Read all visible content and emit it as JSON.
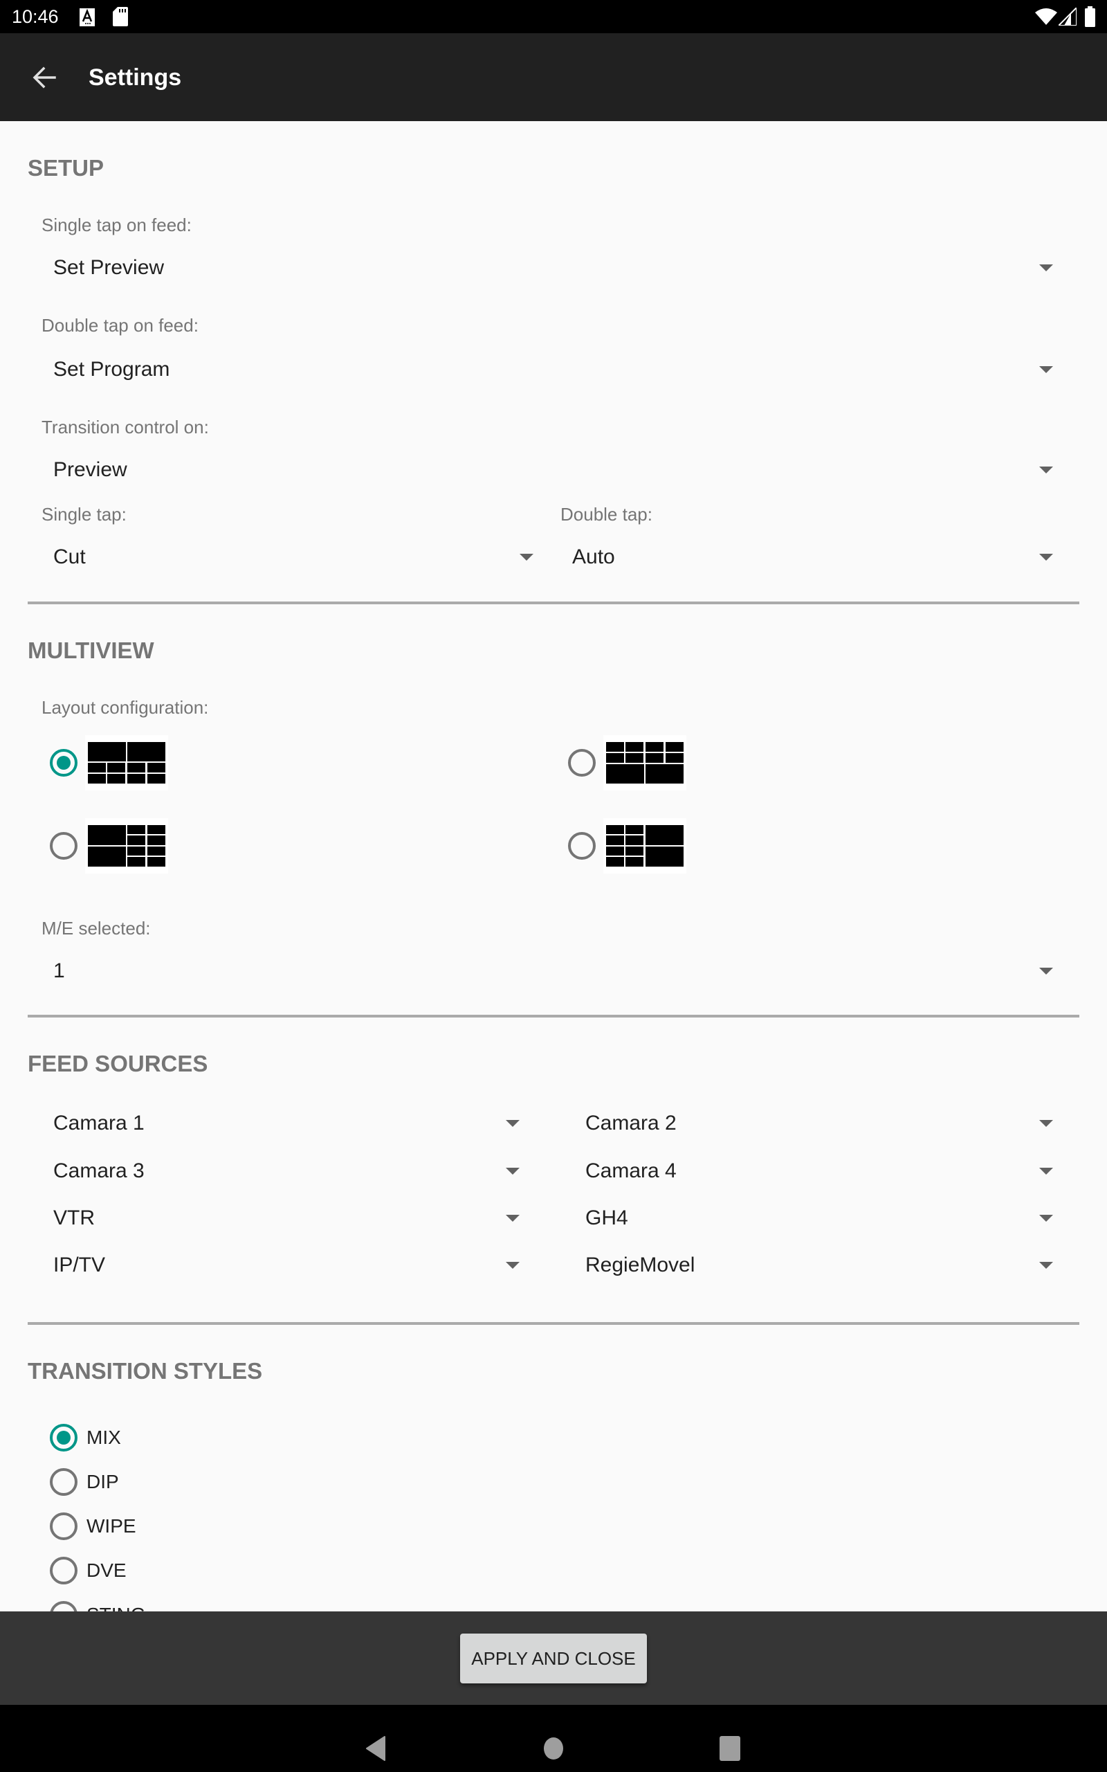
{
  "status_bar": {
    "time": "10:46",
    "left_icons": [
      "keyboard-a-icon",
      "sd-card-icon"
    ],
    "right_icons": [
      "wifi-icon",
      "cell-signal-icon",
      "battery-icon"
    ]
  },
  "toolbar": {
    "title": "Settings",
    "back_icon": "arrow-back-icon"
  },
  "colors": {
    "accent": "#009688",
    "toolbar_bg": "#212121",
    "section_heading": "#757575",
    "divider": "#aaaaaa",
    "bottom_bar_bg": "#363636",
    "button_bg": "#d6d7d7"
  },
  "setup": {
    "heading": "SETUP",
    "single_tap_feed": {
      "label": "Single tap on feed:",
      "value": "Set Preview"
    },
    "double_tap_feed": {
      "label": "Double tap on feed:",
      "value": "Set Program"
    },
    "transition_control": {
      "label": "Transition control on:",
      "value": "Preview"
    },
    "single_tap": {
      "label": "Single tap:",
      "value": "Cut"
    },
    "double_tap": {
      "label": "Double tap:",
      "value": "Auto"
    }
  },
  "multiview": {
    "heading": "MULTIVIEW",
    "layout_label": "Layout configuration:",
    "layouts": [
      {
        "name": "two-large-top-eight-small-bottom",
        "selected": true
      },
      {
        "name": "eight-small-top-two-large-bottom",
        "selected": false
      },
      {
        "name": "two-large-left-eight-small-right",
        "selected": false
      },
      {
        "name": "eight-small-left-two-large-right",
        "selected": false
      }
    ],
    "me_label": "M/E selected:",
    "me_value": "1"
  },
  "feed_sources": {
    "heading": "FEED SOURCES",
    "items": [
      "Camara 1",
      "Camara 2",
      "Camara 3",
      "Camara 4",
      "VTR",
      "GH4",
      "IP/TV",
      "RegieMovel"
    ]
  },
  "transition_styles": {
    "heading": "TRANSITION STYLES",
    "options": [
      {
        "label": "MIX",
        "selected": true
      },
      {
        "label": "DIP",
        "selected": false
      },
      {
        "label": "WIPE",
        "selected": false
      },
      {
        "label": "DVE",
        "selected": false
      },
      {
        "label": "STING",
        "selected": false
      }
    ]
  },
  "footer": {
    "apply_label": "APPLY AND CLOSE"
  },
  "nav_bar": {
    "buttons": [
      "nav-back-icon",
      "nav-home-icon",
      "nav-recents-icon"
    ]
  }
}
